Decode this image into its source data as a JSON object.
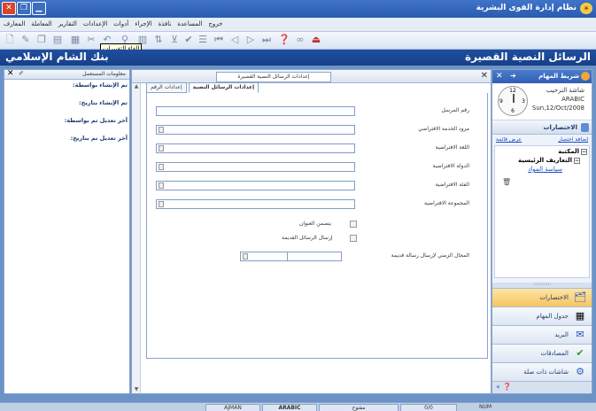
{
  "window": {
    "title": "نظام إدارة القوى البشرية"
  },
  "menu": [
    "خروج",
    "المساعدة",
    "نافذة",
    "الإجراء",
    "أدوات",
    "الإعدادات",
    "التقارير",
    "المعاملة",
    "المعارف"
  ],
  "tooltip": "إلغاء التغييرات",
  "banner": {
    "module_title": "الرسائل النصية القصيرة",
    "org_name": "بنك الشام الإسلامي"
  },
  "task_panel": {
    "title": "شريط المهام",
    "greeting": "شاشة الترحيب",
    "language": "ARABIC",
    "date": "Sun,12/Oct/2008",
    "clock": {
      "n12": "12",
      "n3": "3",
      "n6": "6",
      "n9": "9"
    },
    "shortcuts_title": "الاختصارات",
    "link_add": "إضافة اختصار",
    "link_show": "عرض قائمة",
    "tree": {
      "root": "المكتبة",
      "child": "التعاريف الرئيسية",
      "leaf": "سياسة المواد"
    },
    "buttons": [
      {
        "label": "الاختصارات",
        "icon": "shortcuts-icon"
      },
      {
        "label": "جدول المهام",
        "icon": "calendar-icon"
      },
      {
        "label": "البريد",
        "icon": "mail-icon"
      },
      {
        "label": "المصادقات",
        "icon": "approval-icon"
      },
      {
        "label": "شاشات ذات صلة",
        "icon": "related-screens-icon"
      }
    ]
  },
  "main": {
    "tab_title": "إعدادات الرسائل النصية القصيرة",
    "subtabs": [
      "إعدادات الرسائل النصية",
      "إعدادات الرقم"
    ],
    "form": {
      "fields": [
        {
          "label": "رقم المرسل",
          "value": ""
        },
        {
          "label": "مزود الخدمة الافتراضي",
          "value": ""
        },
        {
          "label": "اللغة الافتراضية",
          "value": ""
        },
        {
          "label": "الدولة الافتراضية",
          "value": ""
        },
        {
          "label": "الفئة الافتراضية",
          "value": ""
        },
        {
          "label": "المجموعة الافتراضية",
          "value": ""
        }
      ],
      "chk_title": "يتضمن العنوان",
      "chk_old": "إرسال الرسائل القديمة",
      "time_label": "المجال الزمني لإرسال رسالة قديمة"
    }
  },
  "user_info": {
    "title": "معلومات المستعمل",
    "rows": [
      "تم الإنشاء بواسطة:",
      "تم الإنشاء بتاريخ:",
      "آخر تعديل تم بواسطة:",
      "آخر تعديل تم بتاريخ:"
    ]
  },
  "status": {
    "branch": "AJMAN",
    "language": "ARABIC",
    "state": "مفتوح",
    "counter": "0/0",
    "num": "NUM"
  }
}
